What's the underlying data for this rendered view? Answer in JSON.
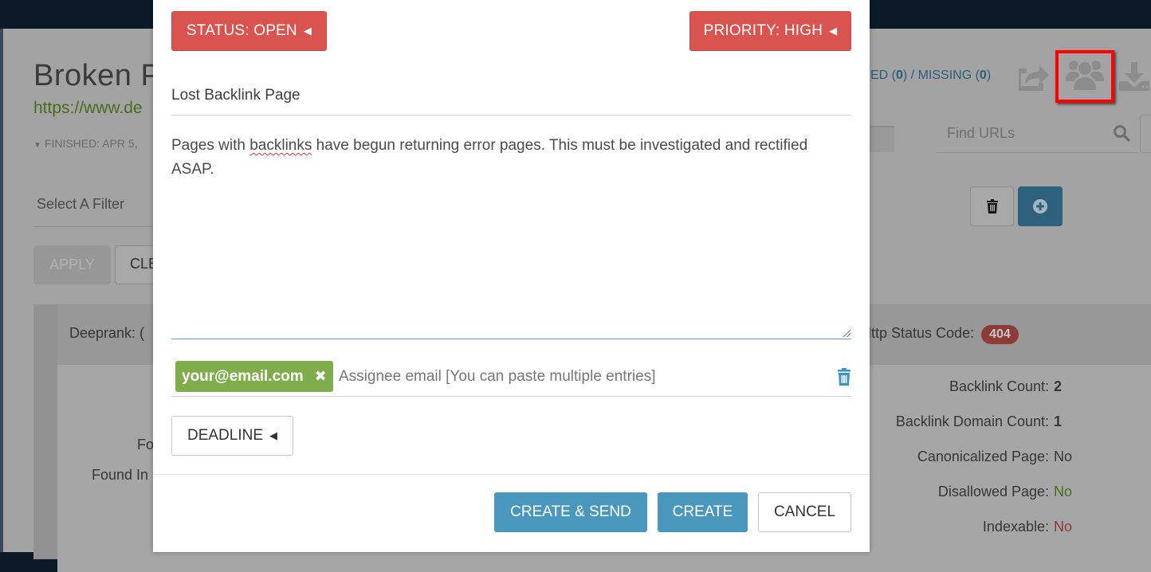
{
  "background": {
    "page_title": "Broken P",
    "page_url": "https://www.de",
    "finished_label": "FINISHED: APR 5,",
    "filter_select_label": "Select A Filter",
    "apply_label": "APPLY",
    "clear_label": "CLE",
    "counts": {
      "prefix": "ED (",
      "ignored_count": "0",
      "mid": ") / MISSING (",
      "missing_count": "0",
      "suffix": ")"
    },
    "toolbar_icons": [
      "share-icon",
      "users-icon",
      "download-icon"
    ],
    "highlighted_icon": "users-icon",
    "search": {
      "placeholder": "Find URLs"
    },
    "card": {
      "deeprank_label": "Deeprank: (",
      "found_a": "Fo",
      "found_b": "Found In",
      "http_status_label": "Http Status Code:",
      "http_status_value": "404",
      "properties": [
        {
          "label": "Backlink Count:",
          "value": "2",
          "style": "bold"
        },
        {
          "label": "Backlink Domain Count:",
          "value": "1",
          "style": "bold"
        },
        {
          "label": "Canonicalized Page:",
          "value": "No",
          "style": "plain"
        },
        {
          "label": "Disallowed Page:",
          "value": "No",
          "style": "green"
        },
        {
          "label": "Indexable:",
          "value": "No",
          "style": "red"
        }
      ]
    }
  },
  "modal": {
    "status_label": "STATUS: OPEN",
    "priority_label": "PRIORITY: HIGH",
    "title_value": "Lost Backlink Page",
    "description": {
      "before": "Pages with ",
      "misspelled": "backlinks",
      "after": " have begun returning error pages. This must be investigated and rectified ASAP."
    },
    "assignees": [
      {
        "email": "your@email.com"
      }
    ],
    "assignee_placeholder": "Assignee email [You can paste multiple entries]",
    "deadline_label": "DEADLINE",
    "buttons": {
      "create_send": "CREATE & SEND",
      "create": "CREATE",
      "cancel": "CANCEL"
    }
  },
  "colors": {
    "danger": "#d9534f",
    "primary": "#4a97bd",
    "tag_green": "#7fad4c",
    "highlight_box": "#ff0000"
  }
}
